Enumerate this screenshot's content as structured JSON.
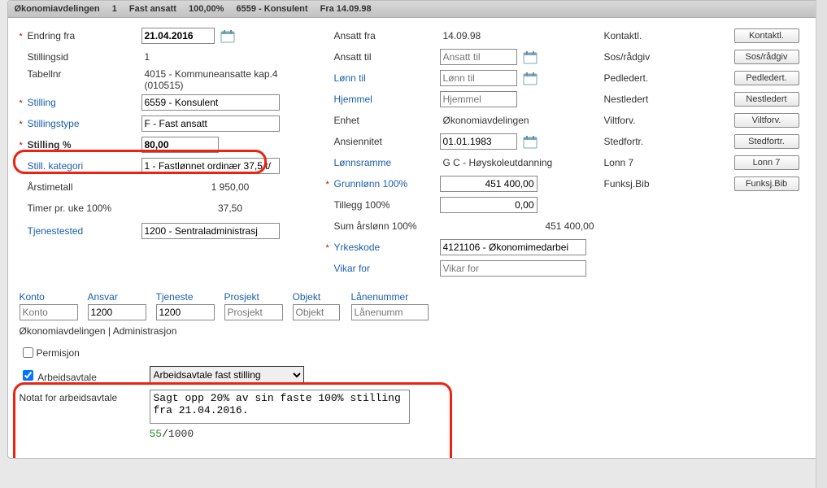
{
  "title": {
    "dept": "Økonomiavdelingen",
    "seq": "1",
    "employment": "Fast ansatt",
    "pct": "100,00%",
    "position": "6559 - Konsulent",
    "from": "Fra  14.09.98"
  },
  "col1": {
    "endring_fra_lbl": "Endring fra",
    "endring_fra_val": "21.04.2016",
    "stillingsid_lbl": "Stillingsid",
    "stillingsid_val": "1",
    "tabellnr_lbl": "Tabellnr",
    "tabellnr_line1": "4015 - Kommuneansatte kap.4",
    "tabellnr_line2": "(010515)",
    "stilling_lbl": "Stilling",
    "stilling_val": "6559 - Konsulent",
    "stillingstype_lbl": "Stillingstype",
    "stillingstype_val": "F - Fast ansatt",
    "stilling_pct_lbl": "Stilling %",
    "stilling_pct_val": "80,00",
    "still_kategori_lbl": "Still. kategori",
    "still_kategori_val": "1 - Fastlønnet ordinær 37,5 t/",
    "arstimetall_lbl": "Årstimetall",
    "arstimetall_val": "1 950,00",
    "timer_pr_uke_lbl": "Timer pr. uke 100%",
    "timer_pr_uke_val": "37,50",
    "tjenestested_lbl": "Tjenestested",
    "tjenestested_val": "1200 - Sentraladministrasj"
  },
  "col2": {
    "ansatt_fra_lbl": "Ansatt fra",
    "ansatt_fra_val": "14.09.98",
    "ansatt_til_lbl": "Ansatt til",
    "ansatt_til_ph": "Ansatt til",
    "lonn_til_lbl": "Lønn til",
    "lonn_til_ph": "Lønn til",
    "hjemmel_lbl": "Hjemmel",
    "hjemmel_ph": "Hjemmel",
    "enhet_lbl": "Enhet",
    "enhet_val": "Økonomiavdelingen",
    "ansiennitet_lbl": "Ansiennitet",
    "ansiennitet_val": "01.01.1983",
    "lonnsramme_lbl": "Lønnsramme",
    "lonnsramme_val": "G C - Høyskoleutdanning",
    "grunnlonn_lbl": "Grunnlønn 100%",
    "grunnlonn_val": "451 400,00",
    "tillegg_lbl": "Tillegg 100%",
    "tillegg_val": "0,00",
    "sum_lbl": "Sum årslønn 100%",
    "sum_val": "451 400,00",
    "yrkeskode_lbl": "Yrkeskode",
    "yrkeskode_val": "4121106 - Økonomimedarbei",
    "vikar_lbl": "Vikar for",
    "vikar_ph": "Vikar for"
  },
  "col3": {
    "items": [
      {
        "label": "Kontaktl.",
        "btn": "Kontaktl."
      },
      {
        "label": "Sos/rådgiv",
        "btn": "Sos/rådgiv"
      },
      {
        "label": "Pedledert.",
        "btn": "Pedledert."
      },
      {
        "label": "Nestledert",
        "btn": "Nestledert"
      },
      {
        "label": "Viltforv.",
        "btn": "Viltforv."
      },
      {
        "label": "Stedfortr.",
        "btn": "Stedfortr."
      },
      {
        "label": "Lonn 7",
        "btn": "Lonn 7"
      },
      {
        "label": "Funksj.Bib",
        "btn": "Funksj.Bib"
      }
    ]
  },
  "dims": {
    "konto": {
      "lbl": "Konto",
      "ph": "Konto"
    },
    "ansvar": {
      "lbl": "Ansvar",
      "val": "1200"
    },
    "tjeneste": {
      "lbl": "Tjeneste",
      "val": "1200"
    },
    "prosjekt": {
      "lbl": "Prosjekt",
      "ph": "Prosjekt"
    },
    "objekt": {
      "lbl": "Objekt",
      "ph": "Objekt"
    },
    "lanenummer": {
      "lbl": "Lånenummer",
      "ph": "Lånenumm"
    },
    "subtitle": "Økonomiavdelingen | Administrasjon"
  },
  "permisjon_lbl": "Permisjon",
  "avtale": {
    "chk_lbl": "Arbeidsavtale",
    "select_val": "Arbeidsavtale fast stilling",
    "notat_lbl": "Notat for arbeidsavtale",
    "notat_val": "Sagt opp 20% av sin faste 100% stilling fra 21.04.2016.",
    "count_used": "55",
    "count_sep": "/",
    "count_max": "1000"
  }
}
